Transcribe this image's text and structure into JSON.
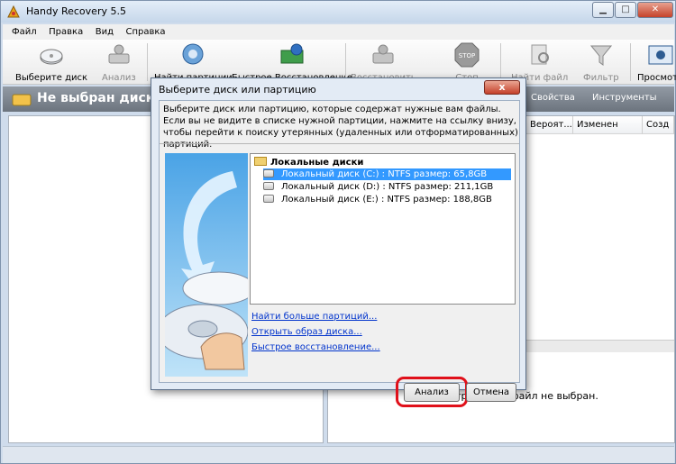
{
  "window": {
    "title": "Handy Recovery 5.5"
  },
  "menu": [
    "Файл",
    "Правка",
    "Вид",
    "Справка"
  ],
  "toolbar": [
    {
      "label": "Выберите диск",
      "icon": "select-disk-icon",
      "enabled": true
    },
    {
      "label": "Анализ",
      "icon": "analyze-icon",
      "enabled": false
    },
    {
      "label": "Найти партиции",
      "icon": "find-partitions-icon",
      "enabled": true
    },
    {
      "label": "Быстрое Восстановление",
      "icon": "quick-recovery-icon",
      "enabled": true
    },
    {
      "label": "Восстановить",
      "icon": "recover-icon",
      "enabled": false
    },
    {
      "label": "Стоп",
      "icon": "stop-icon",
      "enabled": false
    },
    {
      "label": "Найти файл",
      "icon": "find-file-icon",
      "enabled": false
    },
    {
      "label": "Фильтр",
      "icon": "filter-icon",
      "enabled": false
    },
    {
      "label": "Просмотр",
      "icon": "view-icon",
      "enabled": true
    }
  ],
  "subheader": {
    "title": "Не выбран диск или партиция",
    "properties": "Свойства",
    "tools": "Инструменты"
  },
  "file_list": {
    "columns": [
      "Вероят...",
      "Изменен",
      "Созд"
    ]
  },
  "preview": {
    "text": "Просмотр файла: файл не выбран."
  },
  "dialog": {
    "title": "Выберите диск или партицию",
    "description": "Выберите диск или партицию, которые содержат нужные вам файлы. Если вы не видите в списке нужной партиции, нажмите на ссылку внизу, чтобы перейти к поиску утерянных (удаленных или отформатированных) партиций.",
    "tree_root": "Локальные диски",
    "disks": [
      {
        "label": "Локальный диск (C:) : NTFS размер: 65,8GB",
        "selected": true
      },
      {
        "label": "Локальный диск (D:) : NTFS размер: 211,1GB",
        "selected": false
      },
      {
        "label": "Локальный диск (E:) : NTFS размер: 188,8GB",
        "selected": false
      }
    ],
    "links": {
      "find_more": "Найти больше партиций...",
      "open_image": "Открыть образ диска...",
      "quick_recovery": "Быстрое восстановление..."
    },
    "buttons": {
      "analyze": "Анализ",
      "cancel": "Отмена"
    },
    "close_label": "x"
  },
  "colors": {
    "highlight": "#e0101a",
    "selection": "#3399ff",
    "link": "#0033cc"
  }
}
